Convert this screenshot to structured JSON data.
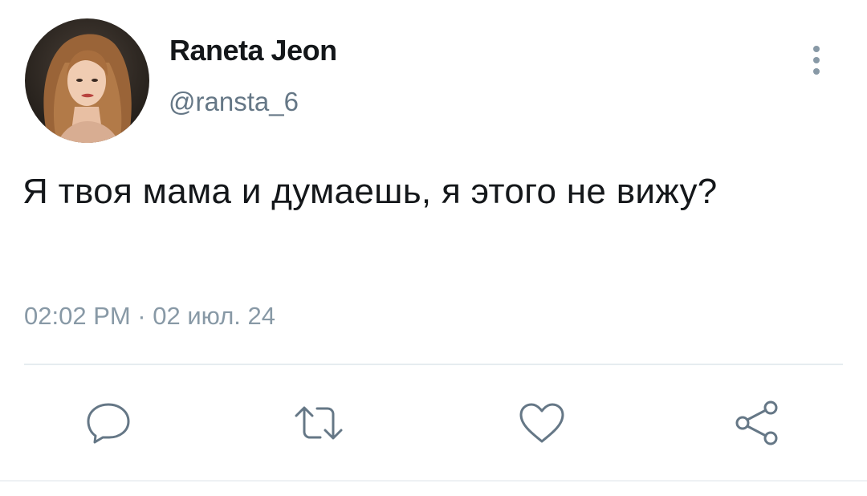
{
  "tweet": {
    "author": {
      "display_name": "Raneta Jeon",
      "handle": "@ransta_6"
    },
    "text": "Я твоя мама и думаешь, я этого не вижу?",
    "timestamp": "02:02 PM · 02 июл. 24"
  },
  "actions": {
    "icons": [
      "reply-icon",
      "retweet-icon",
      "like-icon",
      "share-icon"
    ]
  },
  "colors": {
    "text_primary": "#14171a",
    "text_secondary": "#657786",
    "divider": "#e6ecf0"
  }
}
